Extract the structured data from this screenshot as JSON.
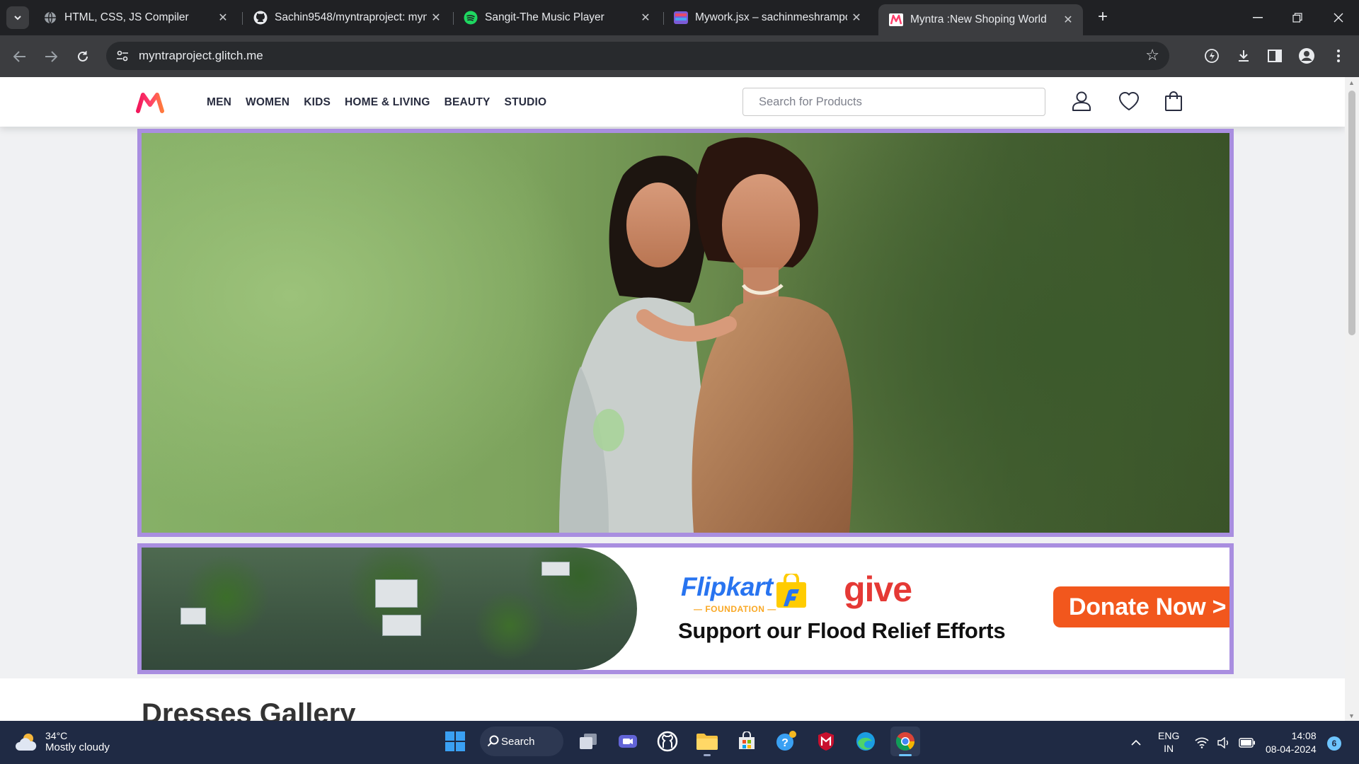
{
  "browser": {
    "tabs": [
      {
        "title": "HTML, CSS, JS Compiler",
        "favicon": "globe-icon"
      },
      {
        "title": "Sachin9548/myntraproject: myntra",
        "favicon": "github-icon"
      },
      {
        "title": "Sangit-The Music Player",
        "favicon": "spotify-icon"
      },
      {
        "title": "Mywork.jsx – sachinmeshrampo",
        "favicon": "figma-icon"
      },
      {
        "title": "Myntra :New Shoping World",
        "favicon": "myntra-icon"
      }
    ],
    "active_tab_index": 4,
    "url": "myntraproject.glitch.me"
  },
  "site": {
    "nav": [
      "MEN",
      "WOMEN",
      "KIDS",
      "HOME & LIVING",
      "BEAUTY",
      "STUDIO"
    ],
    "search_placeholder": "Search for Products",
    "flood_banner": {
      "brand": "Flipkart",
      "brand_sub": "— FOUNDATION —",
      "give": "give",
      "headline": "Support our Flood Relief Efforts",
      "cta": "Donate Now >"
    },
    "section_title": "Dresses Gallery",
    "colors": {
      "brand_pink": "#ff3f6c",
      "banner_border": "#a98ee0",
      "donate": "#f2571d"
    }
  },
  "taskbar": {
    "weather_temp": "34°C",
    "weather_desc": "Mostly cloudy",
    "search_label": "Search",
    "lang_top": "ENG",
    "lang_bottom": "IN",
    "time": "14:08",
    "date": "08-04-2024",
    "notification_count": "6"
  }
}
